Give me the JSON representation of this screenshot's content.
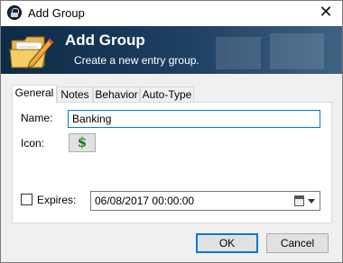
{
  "window": {
    "title": "Add Group",
    "close_glyph": "✕"
  },
  "banner": {
    "title": "Add Group",
    "subtitle": "Create a new entry group.",
    "icon": "folder-pencil-icon"
  },
  "tabs": [
    {
      "label": "General",
      "active": true
    },
    {
      "label": "Notes",
      "active": false
    },
    {
      "label": "Behavior",
      "active": false
    },
    {
      "label": "Auto-Type",
      "active": false
    }
  ],
  "general": {
    "name_label": "Name:",
    "name_value": "Banking",
    "icon_label": "Icon:",
    "icon_glyph": "$",
    "expires_label": "Expires:",
    "expires_checked": false,
    "expires_value": "06/08/2017 00:00:00"
  },
  "buttons": {
    "ok": "OK",
    "cancel": "Cancel"
  },
  "colors": {
    "banner_dark": "#0f2a45",
    "banner_light": "#3e6282",
    "accent": "#0078d7",
    "icon_green": "#1a7a1a"
  }
}
